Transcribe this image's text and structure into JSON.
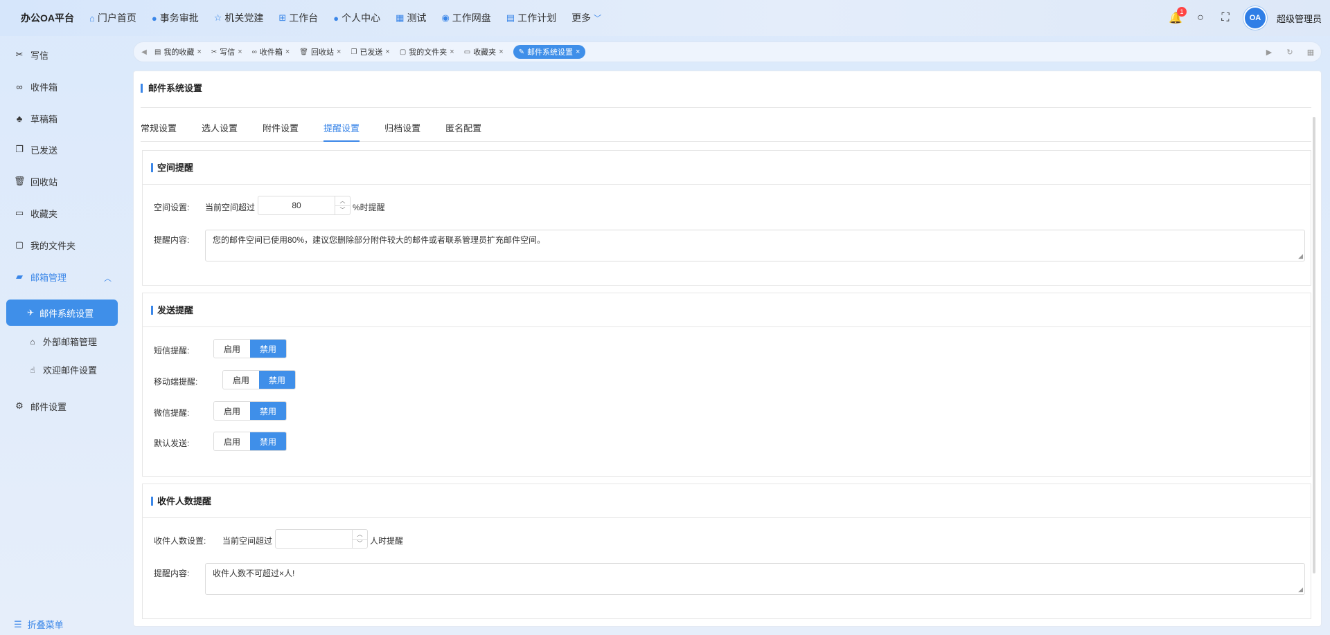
{
  "app": {
    "brand": "办公OA平台"
  },
  "topnav": [
    {
      "icon": "home-icon",
      "glyph": "⌂",
      "label": "门户首页"
    },
    {
      "icon": "approval-icon",
      "glyph": "●",
      "label": "事务审批"
    },
    {
      "icon": "star-icon",
      "glyph": "☆",
      "label": "机关党建"
    },
    {
      "icon": "sitemap-icon",
      "glyph": "⊞",
      "label": "工作台"
    },
    {
      "icon": "user-icon",
      "glyph": "●",
      "label": "个人中心"
    },
    {
      "icon": "grid-icon",
      "glyph": "▦",
      "label": "测试"
    },
    {
      "icon": "database-icon",
      "glyph": "◉",
      "label": "工作网盘"
    },
    {
      "icon": "calendar-icon",
      "glyph": "▤",
      "label": "工作计划"
    }
  ],
  "topnav_more": "更多",
  "notification_count": "1",
  "avatar_text": "OA",
  "username": "超级管理员",
  "sidebar": {
    "items": [
      {
        "label": "写信",
        "glyph": "✂"
      },
      {
        "label": "收件箱",
        "glyph": "∞"
      },
      {
        "label": "草稿箱",
        "glyph": "♣"
      },
      {
        "label": "已发送",
        "glyph": "❐"
      },
      {
        "label": "回收站",
        "glyph": "🗑"
      },
      {
        "label": "收藏夹",
        "glyph": "▭"
      },
      {
        "label": "我的文件夹",
        "glyph": "▢"
      }
    ],
    "group": "邮箱管理",
    "active": "邮件系统设置",
    "subs": [
      "外部邮箱管理",
      "欢迎邮件设置"
    ],
    "settings": "邮件设置",
    "fold": "折叠菜单"
  },
  "tabs": [
    {
      "label": "我的收藏",
      "glyph": "▤"
    },
    {
      "label": "写信",
      "glyph": "✂"
    },
    {
      "label": "收件箱",
      "glyph": "∞"
    },
    {
      "label": "回收站",
      "glyph": "🗑"
    },
    {
      "label": "已发送",
      "glyph": "❐"
    },
    {
      "label": "我的文件夹",
      "glyph": "▢"
    },
    {
      "label": "收藏夹",
      "glyph": "▭"
    },
    {
      "label": "邮件系统设置",
      "glyph": "✎",
      "active": true
    }
  ],
  "panel_title": "邮件系统设置",
  "subtabs": [
    "常规设置",
    "选人设置",
    "附件设置",
    "提醒设置",
    "归档设置",
    "匿名配置"
  ],
  "active_subtab": "提醒设置",
  "space": {
    "title": "空间提醒",
    "label": "空间设置:",
    "prefix": "当前空间超过",
    "value": "80",
    "suffix": "%时提醒",
    "content_label": "提醒内容:",
    "content": "您的邮件空间已使用80%，建议您删除部分附件较大的邮件或者联系管理员扩充邮件空间。"
  },
  "send": {
    "title": "发送提醒",
    "enable": "启用",
    "disable": "禁用",
    "rows": [
      {
        "label": "短信提醒:",
        "value": "禁用"
      },
      {
        "label": "移动端提醒:",
        "value": "禁用"
      },
      {
        "label": "微信提醒:",
        "value": "禁用"
      },
      {
        "label": "默认发送:",
        "value": "禁用"
      }
    ]
  },
  "recipients": {
    "title": "收件人数提醒",
    "label": "收件人数设置:",
    "prefix": "当前空间超过",
    "value": "",
    "suffix": "人时提醒",
    "content_label": "提醒内容:",
    "content": "收件人数不可超过×人!"
  }
}
